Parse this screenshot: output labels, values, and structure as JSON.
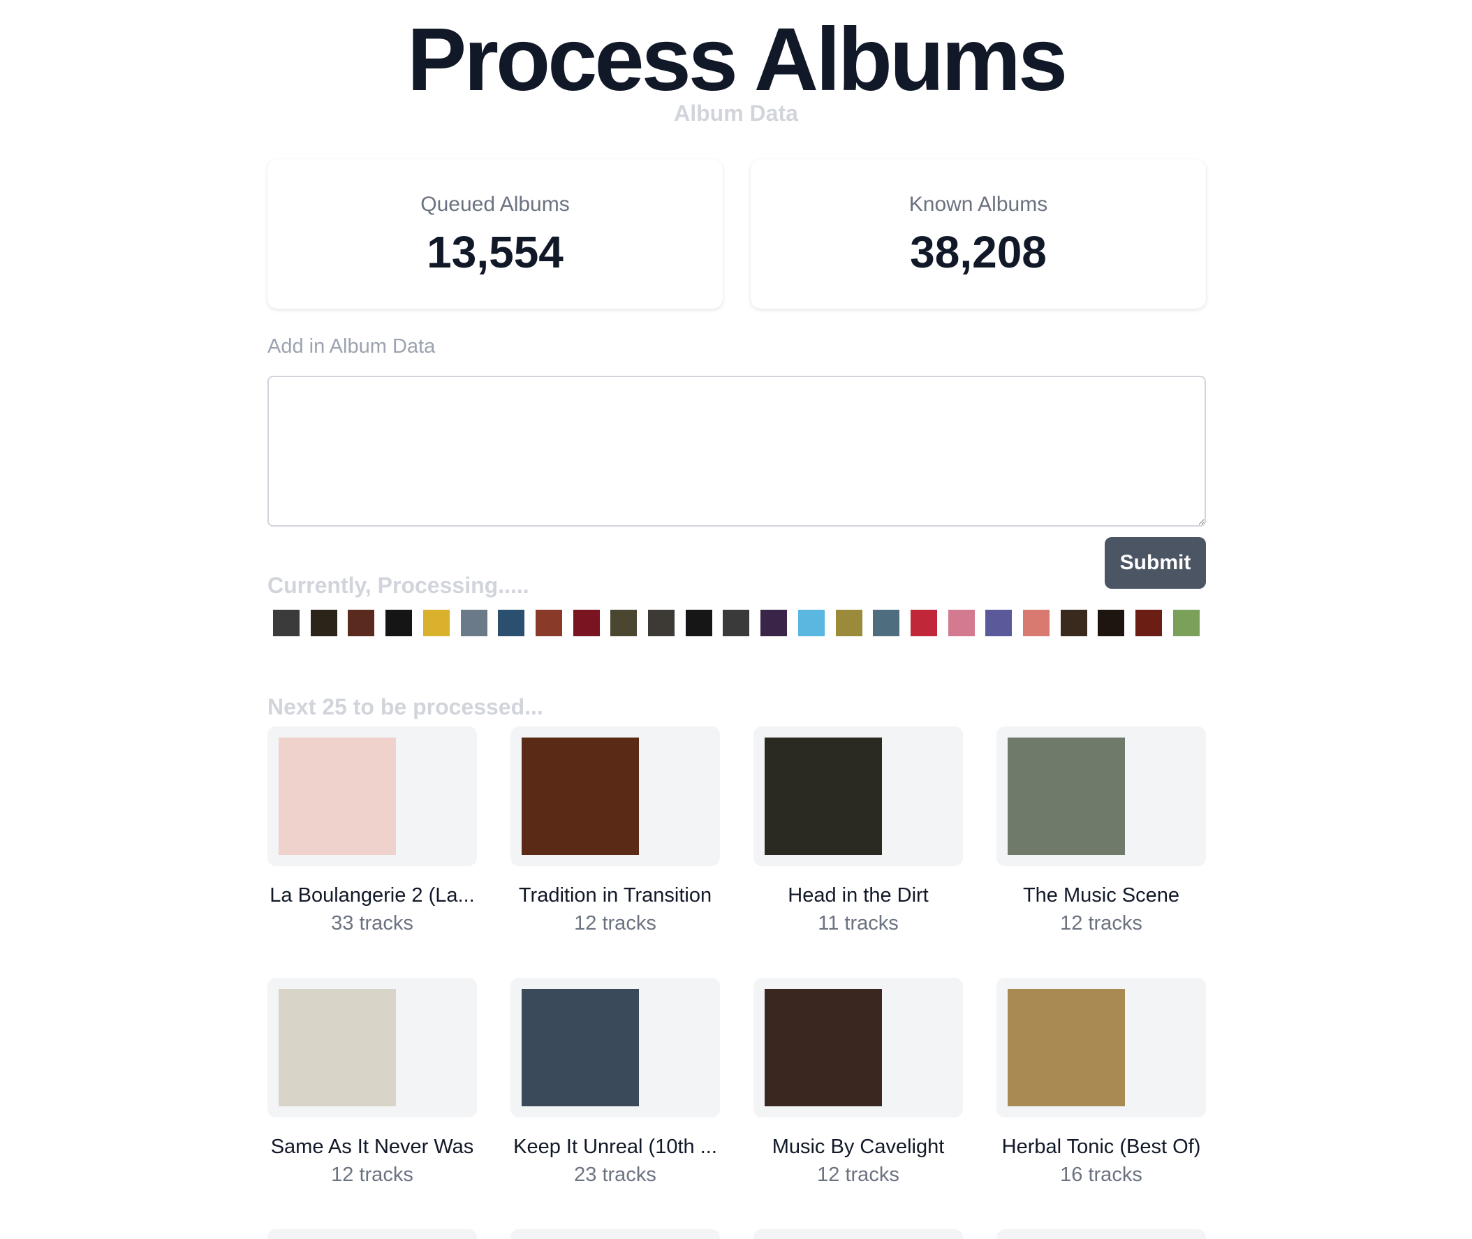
{
  "header": {
    "title": "Process Albums",
    "subtitle": "Album Data"
  },
  "stats": {
    "queued": {
      "label": "Queued Albums",
      "value": "13,554"
    },
    "known": {
      "label": "Known Albums",
      "value": "38,208"
    }
  },
  "form": {
    "label": "Add in Album Data",
    "value": "",
    "submit_label": "Submit"
  },
  "processing": {
    "heading": "Currently, Processing.....",
    "thumb_colors": [
      "#3b3b3b",
      "#2c2418",
      "#5a2a1e",
      "#151515",
      "#d9b12c",
      "#6b7a88",
      "#2b4f6e",
      "#8a3a28",
      "#7a1420",
      "#4a4630",
      "#3d3a36",
      "#161616",
      "#3a3a3a",
      "#3a2448",
      "#5ab7e0",
      "#9a8a3a",
      "#4e6e80",
      "#c0283a",
      "#d47a90",
      "#5a5a9a",
      "#d87a70",
      "#3a2a1e",
      "#1e1410",
      "#6a1e14",
      "#7aa05a"
    ]
  },
  "queue": {
    "heading": "Next 25 to be processed...",
    "albums": [
      {
        "title": "La Boulangerie 2 (La...",
        "tracks": "33 tracks",
        "cover": "#f0d2cc"
      },
      {
        "title": "Tradition in Transition",
        "tracks": "12 tracks",
        "cover": "#5a2a16"
      },
      {
        "title": "Head in the Dirt",
        "tracks": "11 tracks",
        "cover": "#2a2a22"
      },
      {
        "title": "The Music Scene",
        "tracks": "12 tracks",
        "cover": "#6f7a6a"
      },
      {
        "title": "Same As It Never Was",
        "tracks": "12 tracks",
        "cover": "#d9d4c8"
      },
      {
        "title": "Keep It Unreal (10th ...",
        "tracks": "23 tracks",
        "cover": "#3a4a5a"
      },
      {
        "title": "Music By Cavelight",
        "tracks": "12 tracks",
        "cover": "#3a2820"
      },
      {
        "title": "Herbal Tonic (Best Of)",
        "tracks": "16 tracks",
        "cover": "#a88a52"
      }
    ]
  }
}
